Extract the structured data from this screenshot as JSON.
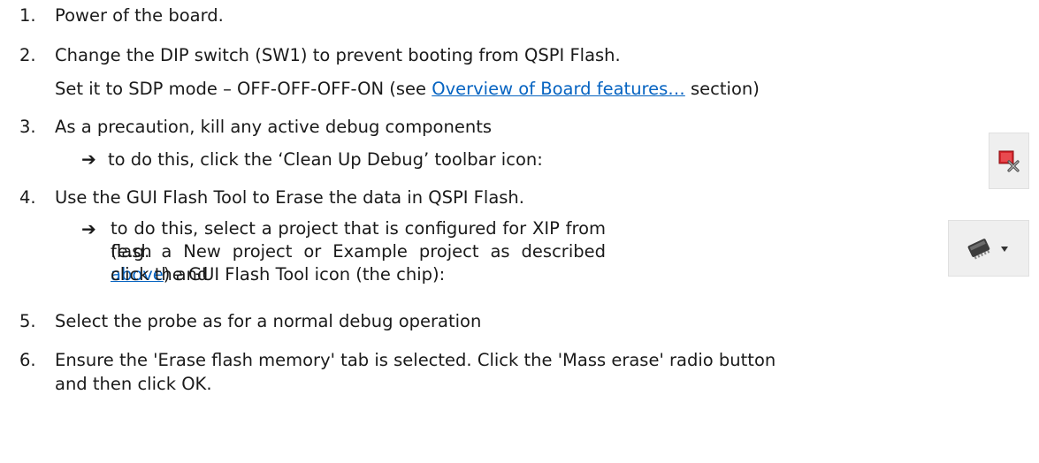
{
  "steps": [
    {
      "num": "1.",
      "text": "Power of the board."
    },
    {
      "num": "2.",
      "text": "Change the DIP switch (SW1) to prevent booting from QSPI Flash.",
      "sub_prefix": "Set it to SDP mode – OFF-OFF-OFF-ON (see ",
      "sub_link": "Overview of Board features…",
      "sub_suffix": " section)"
    },
    {
      "num": "3.",
      "text": "As a precaution, kill any active debug components",
      "arrow_text": "to do this, click the ‘Clean Up Debug’ toolbar icon:"
    },
    {
      "num": "4.",
      "text": "Use the GUI Flash Tool to Erase the data in QSPI Flash.",
      "arrow_line1": "to do this, select a project that is configured for XIP from flash",
      "arrow_line2_prefix": "(e.g. a New project or Example project as described ",
      "arrow_line2_link": "above",
      "arrow_line2_suffix": ") and",
      "arrow_line3": "click the GUI Flash Tool icon (the chip):"
    },
    {
      "num": "5.",
      "text": "Select the probe as for a normal debug operation"
    },
    {
      "num": "6.",
      "text": "Ensure the 'Erase flash memory' tab is selected. Click the 'Mass erase' radio button",
      "text2": "and then click OK."
    }
  ],
  "arrow_glyph": "➔",
  "icons": {
    "clean_up_debug": "clean-up-debug-icon",
    "gui_flash_tool": "chip-icon",
    "dropdown": "dropdown-arrow-icon"
  }
}
